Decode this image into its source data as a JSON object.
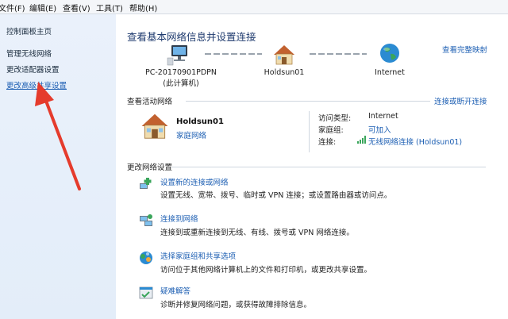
{
  "menubar": {
    "items": [
      "文件(F)",
      "编辑(E)",
      "查看(V)",
      "工具(T)",
      "帮助(H)"
    ]
  },
  "sidebar": {
    "items": [
      "控制面板主页",
      "管理无线网络",
      "更改适配器设置",
      "更改高级共享设置"
    ]
  },
  "main": {
    "title": "查看基本网络信息并设置连接",
    "see_full_map": "查看完整映射",
    "nodes": {
      "pc_name": "PC-20170901PDPN",
      "pc_sub": "(此计算机)",
      "network": "Holdsun01",
      "internet": "Internet"
    },
    "active_section": {
      "label": "查看活动网络",
      "connect_link": "连接或断开连接",
      "network_name": "Holdsun01",
      "network_type": "家庭网络",
      "access_type_label": "访问类型:",
      "access_type_value": "Internet",
      "homegroup_label": "家庭组:",
      "homegroup_value": "可加入",
      "connection_label": "连接:",
      "connection_value": "无线网络连接 (Holdsun01)"
    },
    "change_section": {
      "label": "更改网络设置",
      "tasks": [
        {
          "title": "设置新的连接或网络",
          "desc": "设置无线、宽带、拨号、临时或 VPN 连接；或设置路由器或访问点。"
        },
        {
          "title": "连接到网络",
          "desc": "连接到或重新连接到无线、有线、拨号或 VPN 网络连接。"
        },
        {
          "title": "选择家庭组和共享选项",
          "desc": "访问位于其他网络计算机上的文件和打印机，或更改共享设置。"
        },
        {
          "title": "疑难解答",
          "desc": "诊断并修复网络问题，或获得故障排除信息。"
        }
      ]
    }
  },
  "colors": {
    "link": "#1d5fb3",
    "sidebar_bg": "#e3edf9",
    "arrow": "#e53b2c",
    "title": "#1e3a6e"
  },
  "icons": [
    "computer-icon",
    "house-icon",
    "globe-icon",
    "network-setup-icon",
    "connect-network-icon",
    "homegroup-icon",
    "troubleshoot-icon",
    "signal-bars-icon"
  ]
}
